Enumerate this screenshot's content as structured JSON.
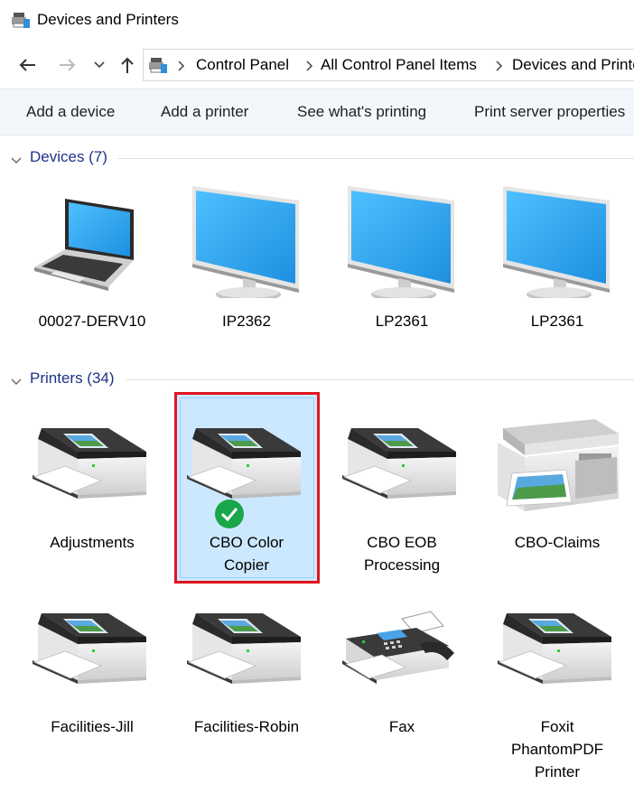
{
  "window": {
    "title": "Devices and Printers"
  },
  "breadcrumb": [
    "Control Panel",
    "All Control Panel Items",
    "Devices and Printers"
  ],
  "toolbar": {
    "add_device": "Add a device",
    "add_printer": "Add a printer",
    "see_printing": "See what's printing",
    "print_server": "Print server properties"
  },
  "devices": {
    "header": "Devices (7)",
    "items": [
      {
        "label": "00027-DERV10",
        "icon": "laptop-icon"
      },
      {
        "label": "IP2362",
        "icon": "monitor-icon"
      },
      {
        "label": "LP2361",
        "icon": "monitor-icon"
      },
      {
        "label": "LP2361",
        "icon": "monitor-icon"
      }
    ]
  },
  "printers": {
    "header": "Printers (34)",
    "items": [
      {
        "label_lines": [
          "Adjustments"
        ],
        "icon": "printer-icon"
      },
      {
        "label_lines": [
          "CBO Color",
          "Copier"
        ],
        "icon": "printer-icon",
        "default": true,
        "selected": true
      },
      {
        "label_lines": [
          "CBO EOB",
          "Processing"
        ],
        "icon": "printer-icon"
      },
      {
        "label_lines": [
          "CBO-Claims"
        ],
        "icon": "multifunction-printer-icon"
      },
      {
        "label_lines": [
          "Facilities-Jill"
        ],
        "icon": "printer-icon"
      },
      {
        "label_lines": [
          "Facilities-Robin"
        ],
        "icon": "printer-icon"
      },
      {
        "label_lines": [
          "Fax"
        ],
        "icon": "fax-icon"
      },
      {
        "label_lines": [
          "Foxit",
          "PhantomPDF",
          "Printer"
        ],
        "icon": "printer-icon"
      }
    ]
  },
  "colors": {
    "group_header": "#1e3287",
    "selection_fill": "#cce8ff",
    "highlight_border": "#e0141e",
    "screen_blue": "#32a5f0",
    "default_check": "#1aa64a"
  }
}
